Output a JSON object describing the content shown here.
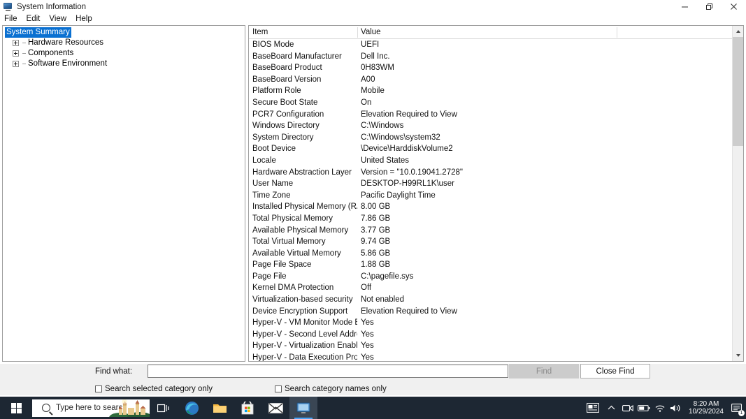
{
  "window": {
    "title": "System Information",
    "icon": "system-information-icon",
    "controls": {
      "minimize": "minimize-icon",
      "restore": "restore-icon",
      "close": "close-icon"
    }
  },
  "menubar": {
    "items": [
      "File",
      "Edit",
      "View",
      "Help"
    ]
  },
  "tree": {
    "root": {
      "label": "System Summary",
      "selected": true
    },
    "children": [
      {
        "label": "Hardware Resources",
        "expanded": false
      },
      {
        "label": "Components",
        "expanded": false
      },
      {
        "label": "Software Environment",
        "expanded": false
      }
    ]
  },
  "list": {
    "columns": [
      "Item",
      "Value"
    ],
    "rows": [
      {
        "item": "BIOS Mode",
        "value": "UEFI"
      },
      {
        "item": "BaseBoard Manufacturer",
        "value": "Dell Inc."
      },
      {
        "item": "BaseBoard Product",
        "value": "0H83WM"
      },
      {
        "item": "BaseBoard Version",
        "value": "A00"
      },
      {
        "item": "Platform Role",
        "value": "Mobile"
      },
      {
        "item": "Secure Boot State",
        "value": "On"
      },
      {
        "item": "PCR7 Configuration",
        "value": "Elevation Required to View"
      },
      {
        "item": "Windows Directory",
        "value": "C:\\Windows"
      },
      {
        "item": "System Directory",
        "value": "C:\\Windows\\system32"
      },
      {
        "item": "Boot Device",
        "value": "\\Device\\HarddiskVolume2"
      },
      {
        "item": "Locale",
        "value": "United States"
      },
      {
        "item": "Hardware Abstraction Layer",
        "value": "Version = \"10.0.19041.2728\""
      },
      {
        "item": "User Name",
        "value": "DESKTOP-H99RL1K\\user"
      },
      {
        "item": "Time Zone",
        "value": "Pacific Daylight Time"
      },
      {
        "item": "Installed Physical Memory (RAM)",
        "value": "8.00 GB"
      },
      {
        "item": "Total Physical Memory",
        "value": "7.86 GB"
      },
      {
        "item": "Available Physical Memory",
        "value": "3.77 GB"
      },
      {
        "item": "Total Virtual Memory",
        "value": "9.74 GB"
      },
      {
        "item": "Available Virtual Memory",
        "value": "5.86 GB"
      },
      {
        "item": "Page File Space",
        "value": "1.88 GB"
      },
      {
        "item": "Page File",
        "value": "C:\\pagefile.sys"
      },
      {
        "item": "Kernel DMA Protection",
        "value": "Off"
      },
      {
        "item": "Virtualization-based security",
        "value": "Not enabled"
      },
      {
        "item": "Device Encryption Support",
        "value": "Elevation Required to View"
      },
      {
        "item": "Hyper-V - VM Monitor Mode E...",
        "value": "Yes"
      },
      {
        "item": "Hyper-V - Second Level Addres...",
        "value": "Yes"
      },
      {
        "item": "Hyper-V - Virtualization Enable...",
        "value": "Yes"
      },
      {
        "item": "Hyper-V - Data Execution Prote...",
        "value": "Yes"
      }
    ]
  },
  "findbar": {
    "label": "Find what:",
    "input_value": "",
    "input_placeholder": "",
    "find_button": "Find",
    "find_button_enabled": false,
    "close_button": "Close Find",
    "checkbox_selected_category": "Search selected category only",
    "checkbox_category_names": "Search category names only",
    "checkbox_selected_category_checked": false,
    "checkbox_category_names_checked": false
  },
  "taskbar": {
    "start": "start-button",
    "search_placeholder": "Type here to search",
    "apps": [
      {
        "name": "task-view",
        "label": "Task View"
      },
      {
        "name": "microsoft-edge",
        "label": "Microsoft Edge"
      },
      {
        "name": "file-explorer",
        "label": "File Explorer"
      },
      {
        "name": "microsoft-store",
        "label": "Microsoft Store"
      },
      {
        "name": "mail",
        "label": "Mail"
      },
      {
        "name": "system-information",
        "label": "System Information"
      }
    ],
    "tray": {
      "news": "news-and-interests",
      "chevron": "show-hidden-icons",
      "meet": "meet-now",
      "battery": "battery",
      "network": "network",
      "volume": "volume",
      "time": "8:20 AM",
      "date": "10/29/2024",
      "notifications_count": "1"
    }
  },
  "colors": {
    "selection": "#0a70d1",
    "taskbar": "#1d2733",
    "accent": "#4ba3f5"
  }
}
